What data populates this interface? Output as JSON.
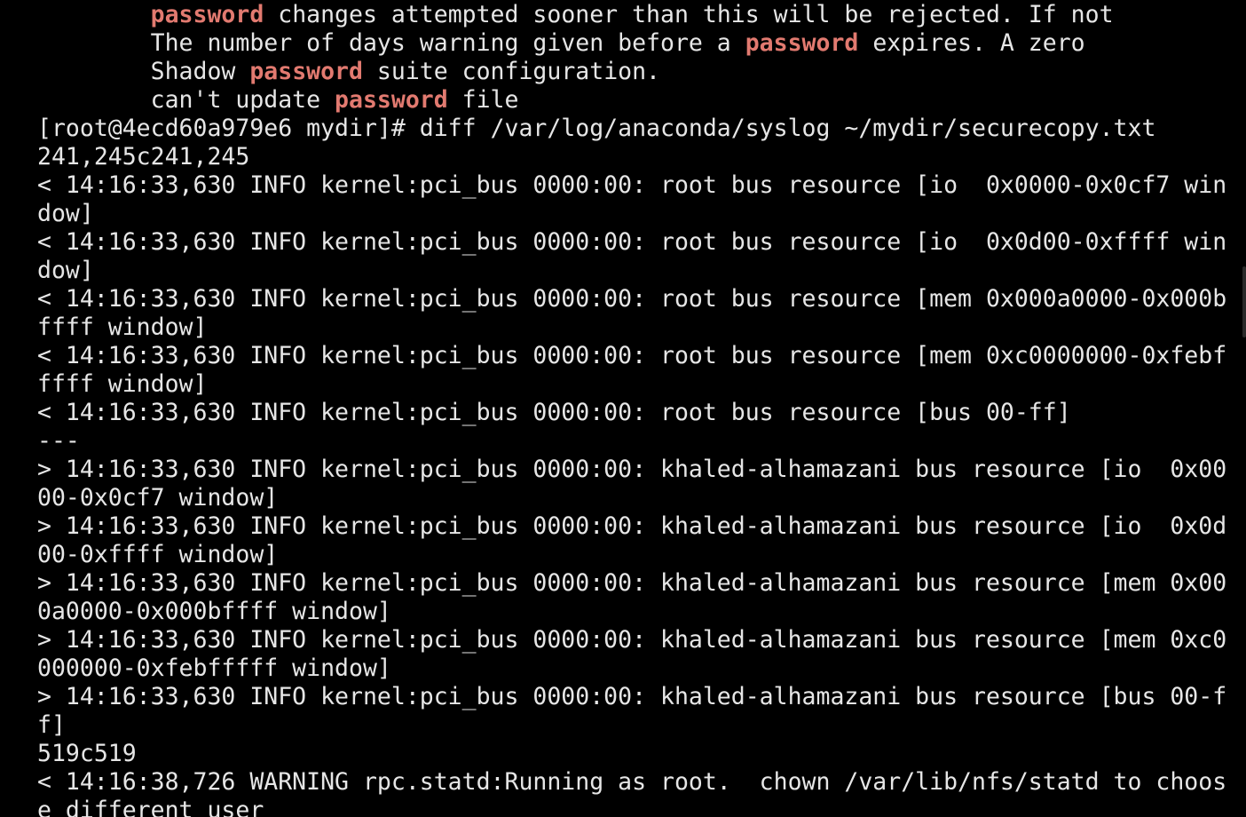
{
  "terminal": {
    "colors": {
      "background": "#000000",
      "foreground": "#e6e6e6",
      "match_highlight": "#e27a70"
    },
    "lines": [
      {
        "segments": [
          {
            "text": "        "
          },
          {
            "text": "password",
            "highlight": true
          },
          {
            "text": " changes attempted sooner than this will be rejected. If not"
          }
        ]
      },
      {
        "segments": [
          {
            "text": "        The number of days warning given before a "
          },
          {
            "text": "password",
            "highlight": true
          },
          {
            "text": " expires. A zero"
          }
        ]
      },
      {
        "segments": [
          {
            "text": "        Shadow "
          },
          {
            "text": "password",
            "highlight": true
          },
          {
            "text": " suite configuration."
          }
        ]
      },
      {
        "segments": [
          {
            "text": "        can't update "
          },
          {
            "text": "password",
            "highlight": true
          },
          {
            "text": " file"
          }
        ]
      },
      {
        "segments": [
          {
            "text": "[root@4ecd60a979e6 mydir]# diff /var/log/anaconda/syslog ~/mydir/securecopy.txt"
          }
        ]
      },
      {
        "segments": [
          {
            "text": "241,245c241,245"
          }
        ]
      },
      {
        "segments": [
          {
            "text": "< 14:16:33,630 INFO kernel:pci_bus 0000:00: root bus resource [io  0x0000-0x0cf7 win"
          }
        ]
      },
      {
        "segments": [
          {
            "text": "dow]"
          }
        ]
      },
      {
        "segments": [
          {
            "text": "< 14:16:33,630 INFO kernel:pci_bus 0000:00: root bus resource [io  0x0d00-0xffff win"
          }
        ]
      },
      {
        "segments": [
          {
            "text": "dow]"
          }
        ]
      },
      {
        "segments": [
          {
            "text": "< 14:16:33,630 INFO kernel:pci_bus 0000:00: root bus resource [mem 0x000a0000-0x000b"
          }
        ]
      },
      {
        "segments": [
          {
            "text": "ffff window]"
          }
        ]
      },
      {
        "segments": [
          {
            "text": "< 14:16:33,630 INFO kernel:pci_bus 0000:00: root bus resource [mem 0xc0000000-0xfebf"
          }
        ]
      },
      {
        "segments": [
          {
            "text": "ffff window]"
          }
        ]
      },
      {
        "segments": [
          {
            "text": "< 14:16:33,630 INFO kernel:pci_bus 0000:00: root bus resource [bus 00-ff]"
          }
        ]
      },
      {
        "segments": [
          {
            "text": "---"
          }
        ]
      },
      {
        "segments": [
          {
            "text": "> 14:16:33,630 INFO kernel:pci_bus 0000:00: khaled-alhamazani bus resource [io  0x00"
          }
        ]
      },
      {
        "segments": [
          {
            "text": "00-0x0cf7 window]"
          }
        ]
      },
      {
        "segments": [
          {
            "text": "> 14:16:33,630 INFO kernel:pci_bus 0000:00: khaled-alhamazani bus resource [io  0x0d"
          }
        ]
      },
      {
        "segments": [
          {
            "text": "00-0xffff window]"
          }
        ]
      },
      {
        "segments": [
          {
            "text": "> 14:16:33,630 INFO kernel:pci_bus 0000:00: khaled-alhamazani bus resource [mem 0x00"
          }
        ]
      },
      {
        "segments": [
          {
            "text": "0a0000-0x000bffff window]"
          }
        ]
      },
      {
        "segments": [
          {
            "text": "> 14:16:33,630 INFO kernel:pci_bus 0000:00: khaled-alhamazani bus resource [mem 0xc0"
          }
        ]
      },
      {
        "segments": [
          {
            "text": "000000-0xfebfffff window]"
          }
        ]
      },
      {
        "segments": [
          {
            "text": "> 14:16:33,630 INFO kernel:pci_bus 0000:00: khaled-alhamazani bus resource [bus 00-f"
          }
        ]
      },
      {
        "segments": [
          {
            "text": "f]"
          }
        ]
      },
      {
        "segments": [
          {
            "text": "519c519"
          }
        ]
      },
      {
        "segments": [
          {
            "text": "< 14:16:38,726 WARNING rpc.statd:Running as root.  chown /var/lib/nfs/statd to choos"
          }
        ]
      },
      {
        "segments": [
          {
            "text": "e different user"
          }
        ]
      }
    ]
  }
}
